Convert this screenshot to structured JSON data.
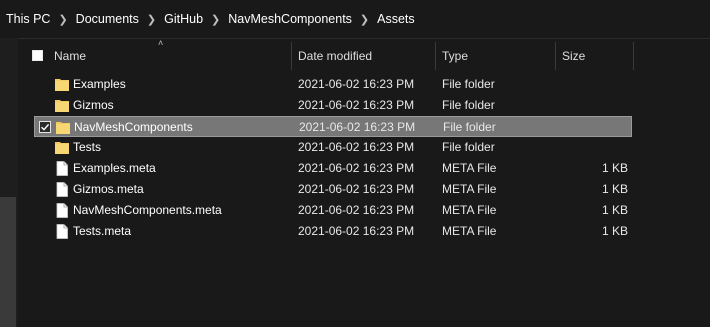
{
  "breadcrumb": [
    "This PC",
    "Documents",
    "GitHub",
    "NavMeshComponents",
    "Assets"
  ],
  "columns": {
    "name": "Name",
    "date_modified": "Date modified",
    "type": "Type",
    "size": "Size"
  },
  "files": [
    {
      "name": "Examples",
      "date": "2021-06-02 16:23 PM",
      "type": "File folder",
      "size": "",
      "icon": "folder-icon",
      "selected": false
    },
    {
      "name": "Gizmos",
      "date": "2021-06-02 16:23 PM",
      "type": "File folder",
      "size": "",
      "icon": "folder-icon",
      "selected": false
    },
    {
      "name": "NavMeshComponents",
      "date": "2021-06-02 16:23 PM",
      "type": "File folder",
      "size": "",
      "icon": "folder-icon",
      "selected": true
    },
    {
      "name": "Tests",
      "date": "2021-06-02 16:23 PM",
      "type": "File folder",
      "size": "",
      "icon": "folder-icon",
      "selected": false
    },
    {
      "name": "Examples.meta",
      "date": "2021-06-02 16:23 PM",
      "type": "META File",
      "size": "1 KB",
      "icon": "file-icon",
      "selected": false
    },
    {
      "name": "Gizmos.meta",
      "date": "2021-06-02 16:23 PM",
      "type": "META File",
      "size": "1 KB",
      "icon": "file-icon",
      "selected": false
    },
    {
      "name": "NavMeshComponents.meta",
      "date": "2021-06-02 16:23 PM",
      "type": "META File",
      "size": "1 KB",
      "icon": "file-icon",
      "selected": false
    },
    {
      "name": "Tests.meta",
      "date": "2021-06-02 16:23 PM",
      "type": "META File",
      "size": "1 KB",
      "icon": "file-icon",
      "selected": false
    }
  ],
  "colors": {
    "background": "#191919",
    "selection": "#777777",
    "folder": "#f4c95d"
  }
}
